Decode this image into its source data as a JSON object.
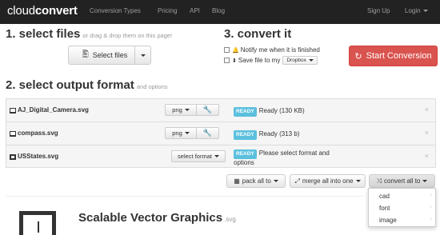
{
  "nav": {
    "brand_light": "cloud",
    "brand_bold": "convert",
    "links": [
      "Conversion Types",
      "Pricing",
      "API",
      "Blog"
    ],
    "sign_up": "Sign Up",
    "login": "Login"
  },
  "step1": {
    "title": "1. select files",
    "hint": "or drag & drop them on this page!",
    "select_button": "Select files"
  },
  "step3": {
    "title": "3. convert it",
    "notify_label": "Notify me when it is finished",
    "save_label": "Save file to my",
    "save_target": "Dropbox",
    "start_button": "Start Conversion"
  },
  "step2": {
    "title": "2. select output format",
    "hint": "and options"
  },
  "files": [
    {
      "name": "AJ_Digital_Camera.svg",
      "format": "png",
      "badge": "READY",
      "status": "Ready (130 KB)"
    },
    {
      "name": "compass.svg",
      "format": "png",
      "badge": "READY",
      "status": "Ready (313 b)"
    },
    {
      "name": "USStates.svg",
      "format": "select format",
      "badge": "READY",
      "status": "Please select format and options"
    }
  ],
  "actions": {
    "pack": "pack all to",
    "merge": "merge all into one",
    "convert": "convert all to"
  },
  "convert_menu": [
    "cad",
    "font",
    "image"
  ],
  "format_info": {
    "title": "Scalable Vector Graphics",
    "ext": ".svg"
  },
  "colors": {
    "navbar": "#222222",
    "start_button": "#d9534f",
    "ready_badge": "#5bc0de"
  }
}
